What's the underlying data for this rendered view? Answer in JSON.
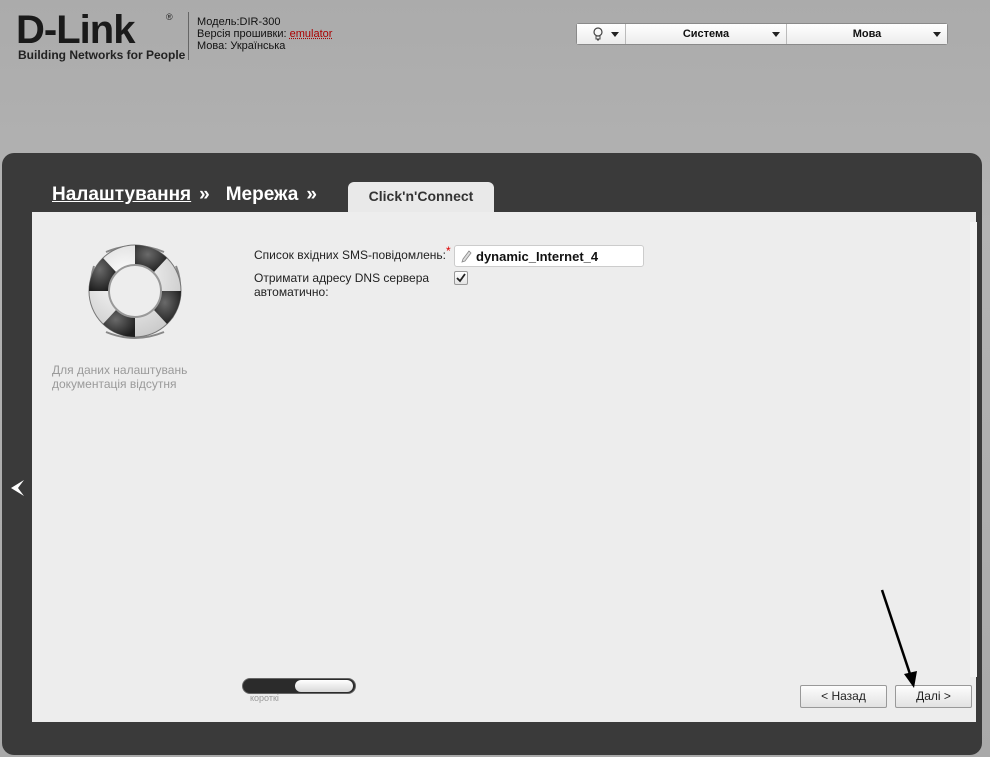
{
  "header": {
    "brand": "D-Link",
    "registered": "®",
    "tagline": "Building Networks for People",
    "model": "Модель:DIR-300",
    "firmware_label": "Версія прошивки:",
    "firmware_value": "emulator",
    "language_line": "Мова: Українська"
  },
  "topbar": {
    "bulb_icon": "lightbulb-icon",
    "system_label": "Система",
    "language_label": "Мова"
  },
  "breadcrumb": {
    "item1": "Налаштування",
    "item2": "Мережа",
    "separator": "»",
    "active_tab": "Click'n'Connect"
  },
  "sidebar": {
    "icon": "lifebuoy-icon",
    "no_docs_text": "Для даних налаштувань документація відсутня"
  },
  "form": {
    "sms_label": "Список вхідних SMS-повідомлень:",
    "required_mark": "*",
    "sms_value": "dynamic_Internet_4",
    "dns_label": "Отримати адресу DNS сервера автоматично:",
    "dns_checked": true
  },
  "footer": {
    "toggle_label": "короткі",
    "back_button": "< Назад",
    "next_button": "Далі >"
  },
  "colors": {
    "frame": "#3a3a3a",
    "content": "#ededed",
    "required": "#dd0000",
    "firmware": "#aa0000"
  }
}
